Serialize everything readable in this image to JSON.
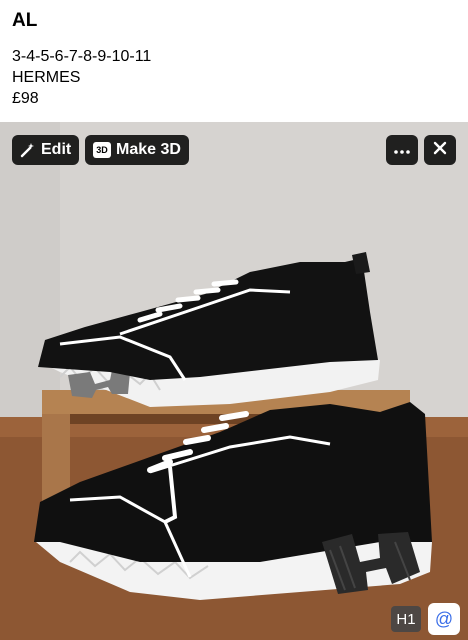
{
  "message": {
    "sender": "AL",
    "sizes": "3-4-5-6-7-8-9-10-11",
    "brand": "HERMES",
    "price": "£98"
  },
  "toolbar": {
    "edit_label": "Edit",
    "make3d_label": "Make 3D",
    "make3d_badge": "3D",
    "more_icon": "more-icon",
    "close_icon": "close-icon"
  },
  "photo": {
    "h1_label": "H1",
    "at_label": "@"
  }
}
